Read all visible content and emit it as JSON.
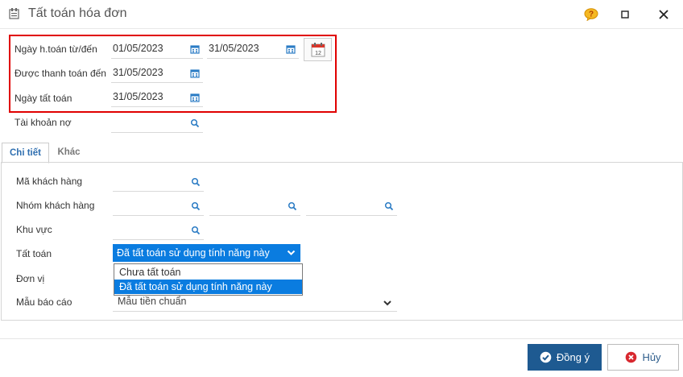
{
  "window": {
    "title": "Tất toán hóa đơn"
  },
  "colors": {
    "accent": "#0a7ce0",
    "highlight_border": "#e00000",
    "ok_button": "#1e5a91"
  },
  "header_fields": {
    "payment_date_label": "Ngày h.toán từ/đến",
    "payment_date_from": "01/05/2023",
    "payment_date_to": "31/05/2023",
    "paid_until_label": "Được thanh toán đến",
    "paid_until": "31/05/2023",
    "settlement_date_label": "Ngày tất toán",
    "settlement_date": "31/05/2023",
    "debit_account_label": "Tài khoản nợ",
    "debit_account": ""
  },
  "tabs": [
    {
      "label": "Chi tiết"
    },
    {
      "label": "Khác"
    }
  ],
  "details": {
    "customer_code_label": "Mã khách hàng",
    "customer_group_label": "Nhóm khách hàng",
    "region_label": "Khu vực",
    "settlement_label": "Tất toán",
    "settlement_selected": "Đã tất toán sử dụng tính năng này",
    "settlement_options": [
      "Chưa tất toán",
      "Đã tất toán sử dụng tính năng này"
    ],
    "unit_label": "Đơn vị",
    "report_template_label": "Mẫu báo cáo",
    "report_template": "Mẫu tiền chuẩn"
  },
  "buttons": {
    "ok": "Đồng ý",
    "cancel": "Hủy"
  }
}
